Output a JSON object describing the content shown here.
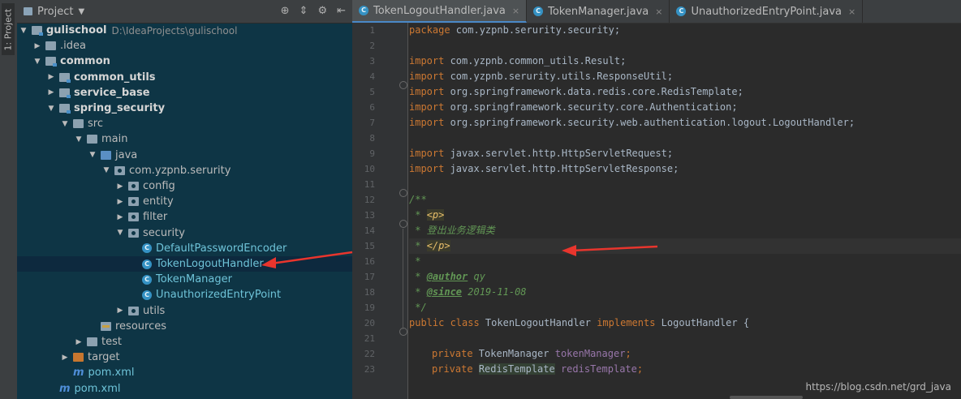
{
  "left_strip": {
    "project_tab": "1: Project"
  },
  "project_panel": {
    "title": "Project",
    "dropdown": "▼",
    "header_icons": [
      "⊕",
      "⇕",
      "⚙",
      "⇤"
    ],
    "tree": [
      {
        "label": "gulischool",
        "path": "D:\\IdeaProjects\\gulischool",
        "indent": 0,
        "arrow": "▼",
        "icon": "module-folder",
        "bold": true
      },
      {
        "label": ".idea",
        "indent": 1,
        "arrow": "▶",
        "icon": "folder"
      },
      {
        "label": "common",
        "indent": 1,
        "arrow": "▼",
        "icon": "module-folder",
        "bold": true
      },
      {
        "label": "common_utils",
        "indent": 2,
        "arrow": "▶",
        "icon": "module-folder",
        "bold": true
      },
      {
        "label": "service_base",
        "indent": 2,
        "arrow": "▶",
        "icon": "module-folder",
        "bold": true
      },
      {
        "label": "spring_security",
        "indent": 2,
        "arrow": "▼",
        "icon": "module-folder",
        "bold": true
      },
      {
        "label": "src",
        "indent": 3,
        "arrow": "▼",
        "icon": "folder"
      },
      {
        "label": "main",
        "indent": 4,
        "arrow": "▼",
        "icon": "folder"
      },
      {
        "label": "java",
        "indent": 5,
        "arrow": "▼",
        "icon": "source-folder"
      },
      {
        "label": "com.yzpnb.serurity",
        "indent": 6,
        "arrow": "▼",
        "icon": "package"
      },
      {
        "label": "config",
        "indent": 7,
        "arrow": "▶",
        "icon": "package"
      },
      {
        "label": "entity",
        "indent": 7,
        "arrow": "▶",
        "icon": "package"
      },
      {
        "label": "filter",
        "indent": 7,
        "arrow": "▶",
        "icon": "package"
      },
      {
        "label": "security",
        "indent": 7,
        "arrow": "▼",
        "icon": "package"
      },
      {
        "label": "DefaultPasswordEncoder",
        "indent": 8,
        "arrow": "",
        "icon": "class"
      },
      {
        "label": "TokenLogoutHandler",
        "indent": 8,
        "arrow": "",
        "icon": "class",
        "selected": true
      },
      {
        "label": "TokenManager",
        "indent": 8,
        "arrow": "",
        "icon": "class"
      },
      {
        "label": "UnauthorizedEntryPoint",
        "indent": 8,
        "arrow": "",
        "icon": "class"
      },
      {
        "label": "utils",
        "indent": 7,
        "arrow": "▶",
        "icon": "package"
      },
      {
        "label": "resources",
        "indent": 5,
        "arrow": "",
        "icon": "resources-folder"
      },
      {
        "label": "test",
        "indent": 4,
        "arrow": "▶",
        "icon": "folder"
      },
      {
        "label": "target",
        "indent": 3,
        "arrow": "▶",
        "icon": "excluded-folder"
      },
      {
        "label": "pom.xml",
        "indent": 3,
        "arrow": "",
        "icon": "maven"
      },
      {
        "label": "pom.xml",
        "indent": 2,
        "arrow": "",
        "icon": "maven"
      }
    ]
  },
  "editor": {
    "tabs": [
      {
        "label": "TokenLogoutHandler.java",
        "active": true,
        "close": "×"
      },
      {
        "label": "TokenManager.java",
        "active": false,
        "close": "×"
      },
      {
        "label": "UnauthorizedEntryPoint.java",
        "active": false,
        "close": "×"
      }
    ],
    "line_numbers": [
      "1",
      "2",
      "3",
      "4",
      "5",
      "6",
      "7",
      "8",
      "9",
      "10",
      "11",
      "12",
      "13",
      "14",
      "15",
      "16",
      "17",
      "18",
      "19",
      "20",
      "21",
      "22",
      "23"
    ],
    "code": {
      "l1_kw": "package",
      "l1_rest": " com.yzpnb.serurity.security;",
      "import_kw": "import",
      "l3": " com.yzpnb.common_utils.Result;",
      "l4": " com.yzpnb.serurity.utils.ResponseUtil;",
      "l5": " org.springframework.data.redis.core.RedisTemplate;",
      "l6": " org.springframework.security.core.Authentication;",
      "l7": " org.springframework.security.web.authentication.logout.LogoutHandler;",
      "l9": " javax.servlet.http.HttpServletRequest;",
      "l10": " javax.servlet.http.HttpServletResponse;",
      "l12": "/**",
      "l13_pre": " * ",
      "l13_tag": "<p>",
      "l14": " * 登出业务逻辑类",
      "l15_pre": " * ",
      "l15_tag": "</p>",
      "l16": " *",
      "l17_pre": " * ",
      "l17_tag": "@author",
      "l17_rest": " qy",
      "l18_pre": " * ",
      "l18_tag": "@since",
      "l18_rest": " 2019-11-08",
      "l19": " */",
      "l20_kw1": "public class",
      "l20_name": " TokenLogoutHandler ",
      "l20_kw2": "implements",
      "l20_rest": " LogoutHandler {",
      "l22_kw": "private",
      "l22_type": " TokenManager ",
      "l22_field": "tokenManager",
      "l22_end": ";",
      "l23_kw": "private",
      "l23_type": "RedisTemplate",
      "l23_field": " redisTemplate",
      "l23_end": ";"
    }
  },
  "watermark": "https://blog.csdn.net/grd_java"
}
